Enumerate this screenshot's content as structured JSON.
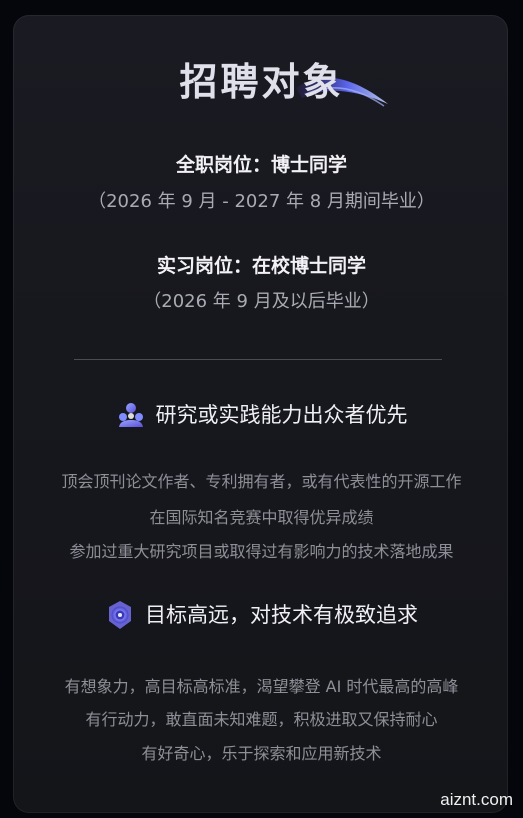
{
  "title": "招聘对象",
  "fulltime": {
    "role": "全职岗位：博士同学",
    "period": "（2026 年 9 月 - 2027 年 8 月期间毕业）"
  },
  "intern": {
    "role": "实习岗位：在校博士同学",
    "period": "（2026 年 9 月及以后毕业）"
  },
  "section1": {
    "icon": "people-group-icon",
    "heading": "研究或实践能力出众者优先",
    "items": [
      "顶会顶刊论文作者、专利拥有者，或有代表性的开源工作",
      "在国际知名竞赛中取得优异成绩",
      "参加过重大研究项目或取得过有影响力的技术落地成果"
    ]
  },
  "section2": {
    "icon": "target-icon",
    "heading": "目标高远，对技术有极致追求",
    "items": [
      "有想象力，高目标高标准，渴望攀登 AI 时代最高的高峰",
      "有行动力，敢直面未知难题，积极进取又保持耐心",
      "有好奇心，乐于探索和应用新技术"
    ]
  },
  "watermark": "aiznt.com",
  "colors": {
    "background": "#05060c",
    "card": "#17181e",
    "heading_text": "#f2f2f5",
    "muted_text": "#8e8f97",
    "accent": "#6d7cff"
  }
}
